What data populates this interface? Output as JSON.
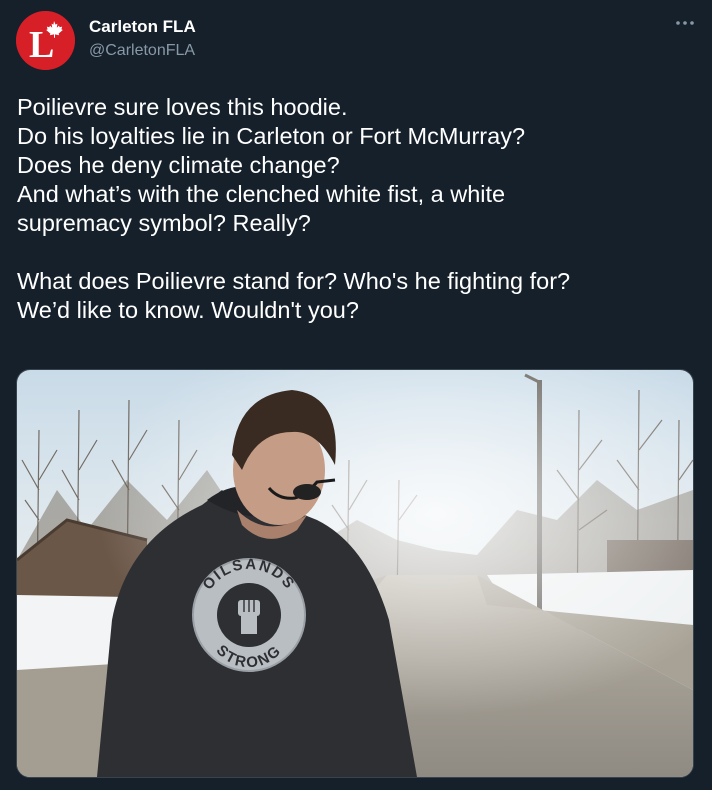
{
  "author": {
    "display_name": "Carleton FLA",
    "handle": "@CarletonFLA",
    "avatar_letter": "L",
    "avatar_icon": "maple-leaf-icon",
    "avatar_color": "#d61f26"
  },
  "menu": {
    "icon": "more-horizontal-icon"
  },
  "tweet": {
    "lines": [
      "Poilievre sure loves this hoodie.",
      "Do his loyalties lie in Carleton or Fort McMurray?",
      "Does he deny climate change?",
      "And what’s with the clenched white fist, a white",
      "supremacy symbol? Really?",
      "",
      "What does Poilievre stand for? Who's he fighting for?",
      "We’d like to know. Wouldn't you?"
    ]
  },
  "media": {
    "logo_top": "OILSANDS",
    "logo_bottom": "STRONG"
  },
  "colors": {
    "background": "#15202b",
    "text": "#ffffff",
    "secondary_text": "#8899a6",
    "border": "#38444d"
  }
}
